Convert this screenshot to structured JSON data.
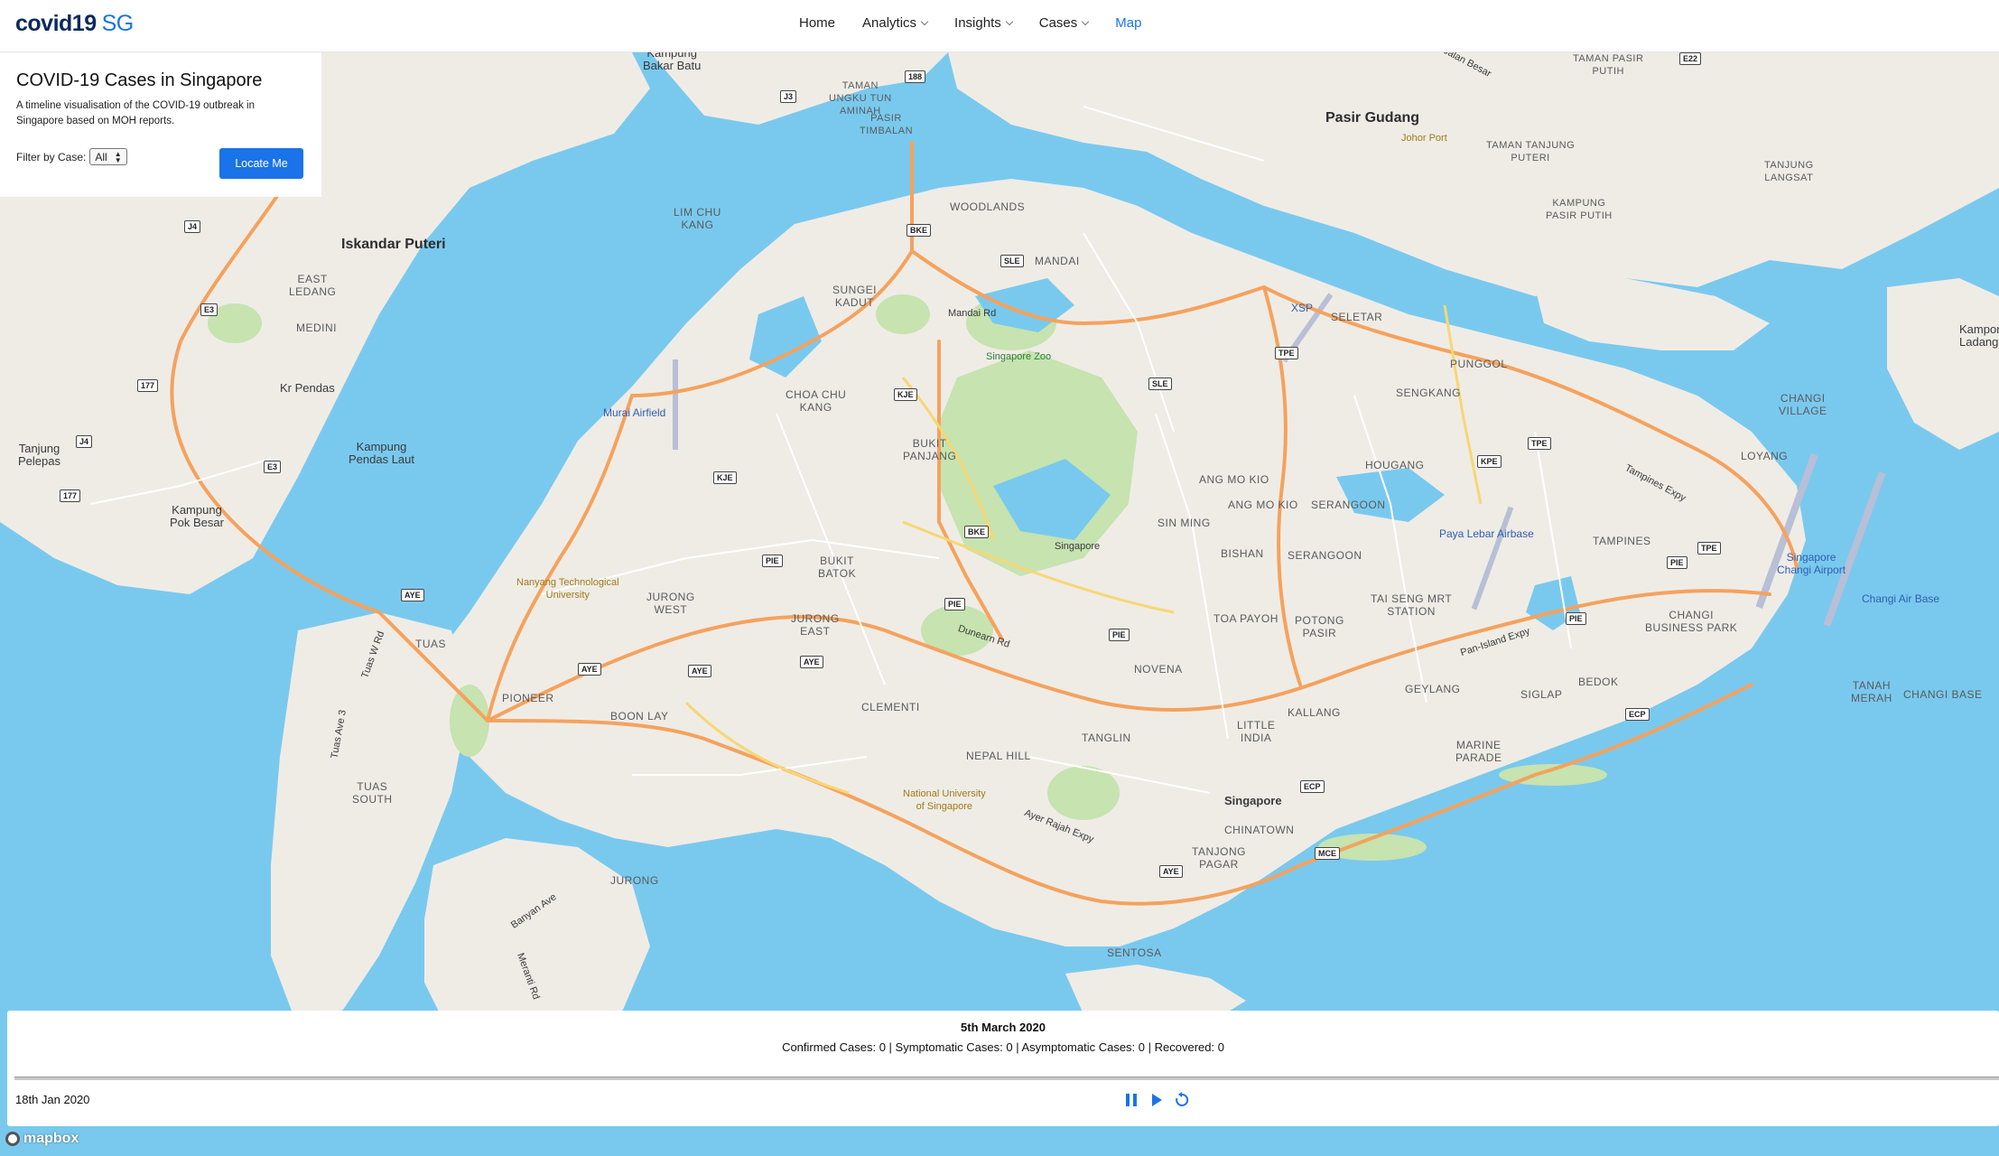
{
  "brand": {
    "name": "covid19",
    "accent": "SG"
  },
  "nav": {
    "items": [
      {
        "label": "Home",
        "dropdown": false,
        "active": false
      },
      {
        "label": "Analytics",
        "dropdown": true,
        "active": false
      },
      {
        "label": "Insights",
        "dropdown": true,
        "active": false
      },
      {
        "label": "Cases",
        "dropdown": true,
        "active": false
      },
      {
        "label": "Map",
        "dropdown": false,
        "active": true
      }
    ]
  },
  "panel": {
    "title": "COVID-19 Cases in Singapore",
    "description": "A timeline visualisation of the COVID-19 outbreak in Singapore based on MOH reports.",
    "filter_label": "Filter by Case:",
    "filter_value": "All",
    "locate_button": "Locate Me"
  },
  "timeline": {
    "current_date": "5th March 2020",
    "stats": "Confirmed Cases: 0 | Symptomatic Cases: 0 | Asymptomatic Cases: 0 | Recovered: 0",
    "start_date": "18th Jan 2020"
  },
  "map": {
    "attribution": "mapbox",
    "colors": {
      "water": "#79c9ee",
      "land": "#efece6",
      "park": "#c6e3b0",
      "highway": "#f5a25d",
      "road": "#ffffff"
    },
    "labels": {
      "pasir_gudang": "Pasir Gudang",
      "johor_port": "Johor Port",
      "iskandar_puteri": "Iskandar Puteri",
      "kampung_bakar_batu": "Kampung\nBakar Batu",
      "taman_ungku_tun_aminah": "TAMAN\nUNGKU TUN\nAMINAH",
      "pasir_timbalan": "PASIR\nTIMBALAN",
      "lim_chu_kang": "LIM CHU\nKANG",
      "woodlands": "WOODLANDS",
      "mandai": "MANDAI",
      "east_ledang": "EAST\nLEDANG",
      "medini": "MEDINI",
      "kr_pendas": "Kr Pendas",
      "tanjung_pelepas": "Tanjung\nPelepas",
      "kampung_pendas_laut": "Kampung\nPendas Laut",
      "kampung_pok_besar": "Kampung\nPok Besar",
      "sungei_kadut": "SUNGEI\nKADUT",
      "mandai_rd": "Mandai Rd",
      "singapore_zoo": "Singapore Zoo",
      "murai_airfield": "Murai Airfield",
      "choa_chu_kang": "CHOA CHU\nKANG",
      "bukit_panjang": "BUKIT\nPANJANG",
      "seletar": "SELETAR",
      "xsp": "XSP",
      "punggol": "PUNGGOL",
      "sengkang": "SENGKANG",
      "hougang": "HOUGANG",
      "ang_mo_kio": "ANG MO KIO",
      "sin_ming": "SIN MING",
      "serangoon": "SERANGOON",
      "paya_lebar_airbase": "Paya Lebar Airbase",
      "tampines": "TAMPINES",
      "changi_village": "CHANGI\nVILLAGE",
      "loyang": "LOYANG",
      "singapore_changi_airport": "Singapore\nChangi Airport",
      "changi_air_base": "Changi Air Base",
      "changi_business_park": "CHANGI\nBUSINESS PARK",
      "tanah_merah": "TANAH\nMERAH",
      "changi_base": "CHANGI BASE",
      "singapore_center": "Singapore",
      "bishan": "BISHAN",
      "toa_payoh": "TOA PAYOH",
      "potong_pasir": "POTONG\nPASIR",
      "tai_seng": "TAI SENG MRT\nSTATION",
      "nanyang": "Nanyang Technological\nUniversity",
      "jurong_west": "JURONG\nWEST",
      "bukit_batok": "BUKIT\nBATOK",
      "jurong_east": "JURONG\nEAST",
      "tuas": "TUAS",
      "pioneer": "PIONEER",
      "boon_lay": "BOON LAY",
      "tuas_south": "TUAS\nSOUTH",
      "tuas_w_rd": "Tuas W Rd",
      "tuas_ave_3": "Tuas Ave 3",
      "clementi": "CLEMENTI",
      "novena": "NOVENA",
      "geylang": "GEYLANG",
      "kallang": "KALLANG",
      "little_india": "LITTLE\nINDIA",
      "bedok": "BEDOK",
      "siglap": "SIGLAP",
      "marine_parade": "MARINE\nPARADE",
      "tanglin": "TANGLIN",
      "nepal_hill": "NEPAL HILL",
      "nus": "National University\nof Singapore",
      "dunearn_rd": "Dunearn Rd",
      "ayer_rajah": "Ayer Rajah Expy",
      "pan_island": "Pan-Island Expy",
      "tampines_expy": "Tampines Expy",
      "singapore_city": "Singapore",
      "chinatown": "CHINATOWN",
      "tanjong_pagar": "TANJONG\nPAGAR",
      "sentosa": "SENTOSA",
      "jurong": "JURONG",
      "banyan_ave": "Banyan Ave",
      "meranti_rd": "Meranti Rd",
      "jalan_besar": "Jalan Besar",
      "taman_pasir_putih": "TAMAN PASIR\nPUTIH",
      "taman_tanjung_puteri": "TAMAN TANJUNG\nPUTERI",
      "kampung_pasir_putih": "KAMPUNG\nPASIR PUTIH",
      "tanjung_langsat": "TANJUNG\nLANGSAT",
      "kampong_ladang": "Kampon\nLadang"
    },
    "shields": [
      "E22",
      "J3",
      "188",
      "BKE",
      "SLE",
      "TPE",
      "SLE",
      "KJE",
      "KJE",
      "BKE",
      "PIE",
      "PIE",
      "PIE",
      "PIE",
      "AYE",
      "AYE",
      "AYE",
      "AYE",
      "ECP",
      "ECP",
      "MCE",
      "KPE",
      "TPE",
      "TPE",
      "PIE",
      "E3",
      "E3",
      "J4",
      "J4",
      "177",
      "177",
      "AYE"
    ]
  }
}
